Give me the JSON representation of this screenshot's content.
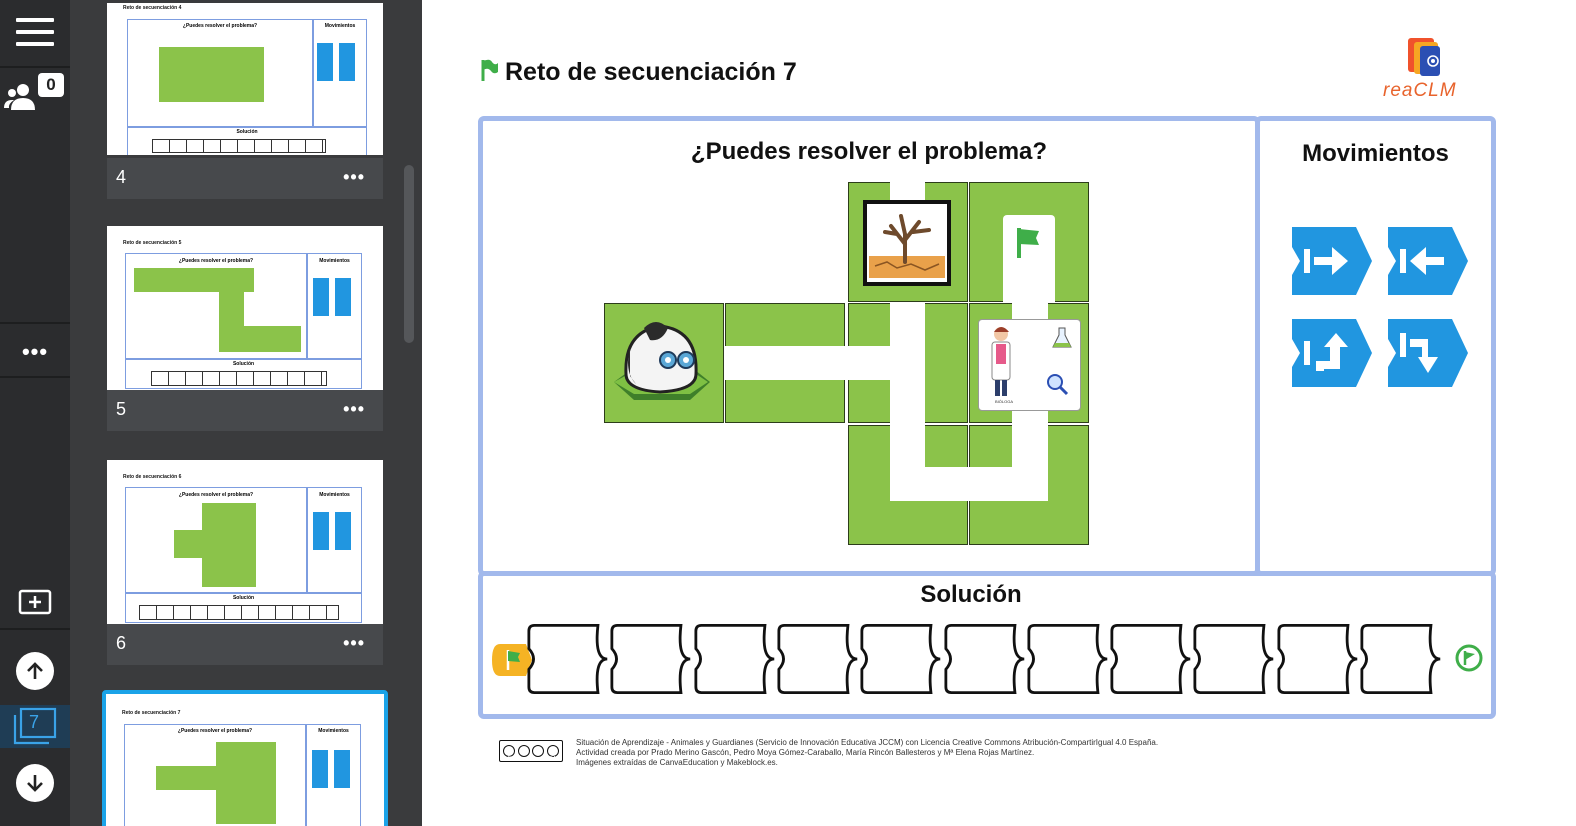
{
  "rail": {
    "participants_count": "0",
    "current_page": "7"
  },
  "thumbnails": [
    {
      "number": "4",
      "title": "Reto de secuenciación 4",
      "question": "¿Puedes resolver el problema?",
      "moves": "Movimientos",
      "solution": "Solución"
    },
    {
      "number": "5",
      "title": "Reto de secuenciación 5",
      "question": "¿Puedes resolver el problema?",
      "moves": "Movimientos",
      "solution": "Solución"
    },
    {
      "number": "6",
      "title": "Reto de secuenciación 6",
      "question": "¿Puedes resolver el problema?",
      "moves": "Movimientos",
      "solution": "Solución"
    },
    {
      "number": "7",
      "title": "Reto de secuenciación 7",
      "question": "¿Puedes resolver el problema?",
      "moves": "Movimientos"
    }
  ],
  "slide": {
    "title": "Reto de secuenciación 7",
    "logo_text": "reaCLM",
    "question": "¿Puedes resolver el problema?",
    "moves_title": "Movimientos",
    "solution_title": "Solución",
    "slot_count": 11,
    "scientist_caption": "BIÓLOGA",
    "footer": [
      "Situación de Aprendizaje - Animales y Guardianes (Servicio de Innovación Educativa JCCM) con Licencia Creative Commons Atribución-CompartirIgual 4.0 España.",
      "Actividad creada por Prado Merino Gascón, Pedro Moya Gómez-Caraballo, María Rincón Ballesteros y Mª Elena Rojas Martínez.",
      "Imágenes extraídas de CanvaEducation y Makeblock.es."
    ],
    "cc_labels": [
      "BY",
      "NC",
      "SA"
    ]
  },
  "colors": {
    "rail_bg": "#2b2c2e",
    "panel_bg": "#3a3b3d",
    "panel_border": "#a2b9ec",
    "grass": "#8bc34a",
    "move_blue": "#2196e0",
    "flag_green": "#3fae49",
    "start_yellow": "#f5b324",
    "selected_border": "#1aa3e8"
  }
}
